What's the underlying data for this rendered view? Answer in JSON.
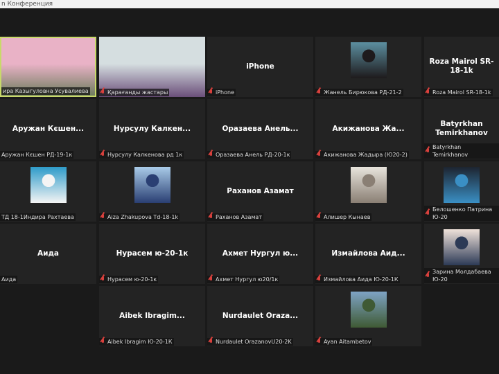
{
  "window": {
    "title": "n Конференция"
  },
  "tiles": [
    {
      "type": "video",
      "label": "ира Казыгуловна Усувалиева",
      "muted": false,
      "active": true,
      "colors": [
        "#e9b2c6",
        "#6e7d5e"
      ]
    },
    {
      "type": "video",
      "label": "Қарағанды жастары",
      "muted": true,
      "colors": [
        "#d5dee0",
        "#6b4f7a"
      ]
    },
    {
      "type": "name",
      "name": "iPhone",
      "label": "iPhone",
      "muted": true
    },
    {
      "type": "photo",
      "label": "Жанель Бирюкова РД-21-2",
      "muted": true,
      "colors": [
        "#5c8fa0",
        "#1e1a1c"
      ]
    },
    {
      "type": "name",
      "name": "Roza Mairol SR-18-1k",
      "label": "Roza Mairol SR-18-1k",
      "muted": true
    },
    {
      "type": "name",
      "name": "Аружан Кєшен...",
      "label": "Аружан Кєшен РД-19-1к",
      "muted": false
    },
    {
      "type": "name",
      "name": "Нурсулу Калкен...",
      "label": "Нурсулу Калкенова рд 1к",
      "muted": true
    },
    {
      "type": "name",
      "name": "Оразаева Анель...",
      "label": "Оразаева Анель РД-20-1к",
      "muted": true
    },
    {
      "type": "name",
      "name": "Акижанова Жа...",
      "label": "Акижанова Жадыра (Ю20-2)",
      "muted": true
    },
    {
      "type": "name",
      "name": "Batyrkhan Temirkhanov",
      "label": "Batyrkhan Temirkhanov",
      "muted": true
    },
    {
      "type": "photo",
      "label": "ТД 18-1Индира Рахтаева",
      "muted": false,
      "colors": [
        "#2e9bc9",
        "#f4f4f4"
      ]
    },
    {
      "type": "photo",
      "label": "Aiza Zhakupova Td-18-1k",
      "muted": true,
      "colors": [
        "#a9cbe8",
        "#2a3f73"
      ]
    },
    {
      "type": "name",
      "name": "Раханов Азамат",
      "label": "Раханов Азамат",
      "muted": true
    },
    {
      "type": "photo",
      "label": "Алишер Кынаев",
      "muted": true,
      "colors": [
        "#e8e4dc",
        "#8a7f74"
      ]
    },
    {
      "type": "photo",
      "label": "Белошенко Патрина Ю-20",
      "muted": true,
      "colors": [
        "#1d2430",
        "#3a8fc4"
      ]
    },
    {
      "type": "name",
      "name": "Аида",
      "label": "Аида",
      "muted": false
    },
    {
      "type": "name",
      "name": "Нурасем ю-20-1к",
      "label": "Нурасем ю-20-1к",
      "muted": true
    },
    {
      "type": "name",
      "name": "Ахмет Нургул ю...",
      "label": "Ахмет Нургул ю20/1к",
      "muted": true
    },
    {
      "type": "name",
      "name": "Измайлова Аид...",
      "label": "Измайлова Аида Ю-20-1К",
      "muted": true
    },
    {
      "type": "photo",
      "label": "Зарина Молдабаева Ю-20",
      "muted": true,
      "colors": [
        "#f0e2da",
        "#2c3a56"
      ]
    },
    null,
    {
      "type": "name",
      "name": "Aibek Ibragim...",
      "label": "Aibek Ibragim Ю-20-1К",
      "muted": true
    },
    {
      "type": "name",
      "name": "Nurdaulet Oraza...",
      "label": "Nurdaulet OrazanovU20-2K",
      "muted": true
    },
    {
      "type": "photo",
      "label": "Ayan Aitambetov",
      "muted": true,
      "colors": [
        "#7ea3c4",
        "#3f5a34"
      ]
    }
  ]
}
